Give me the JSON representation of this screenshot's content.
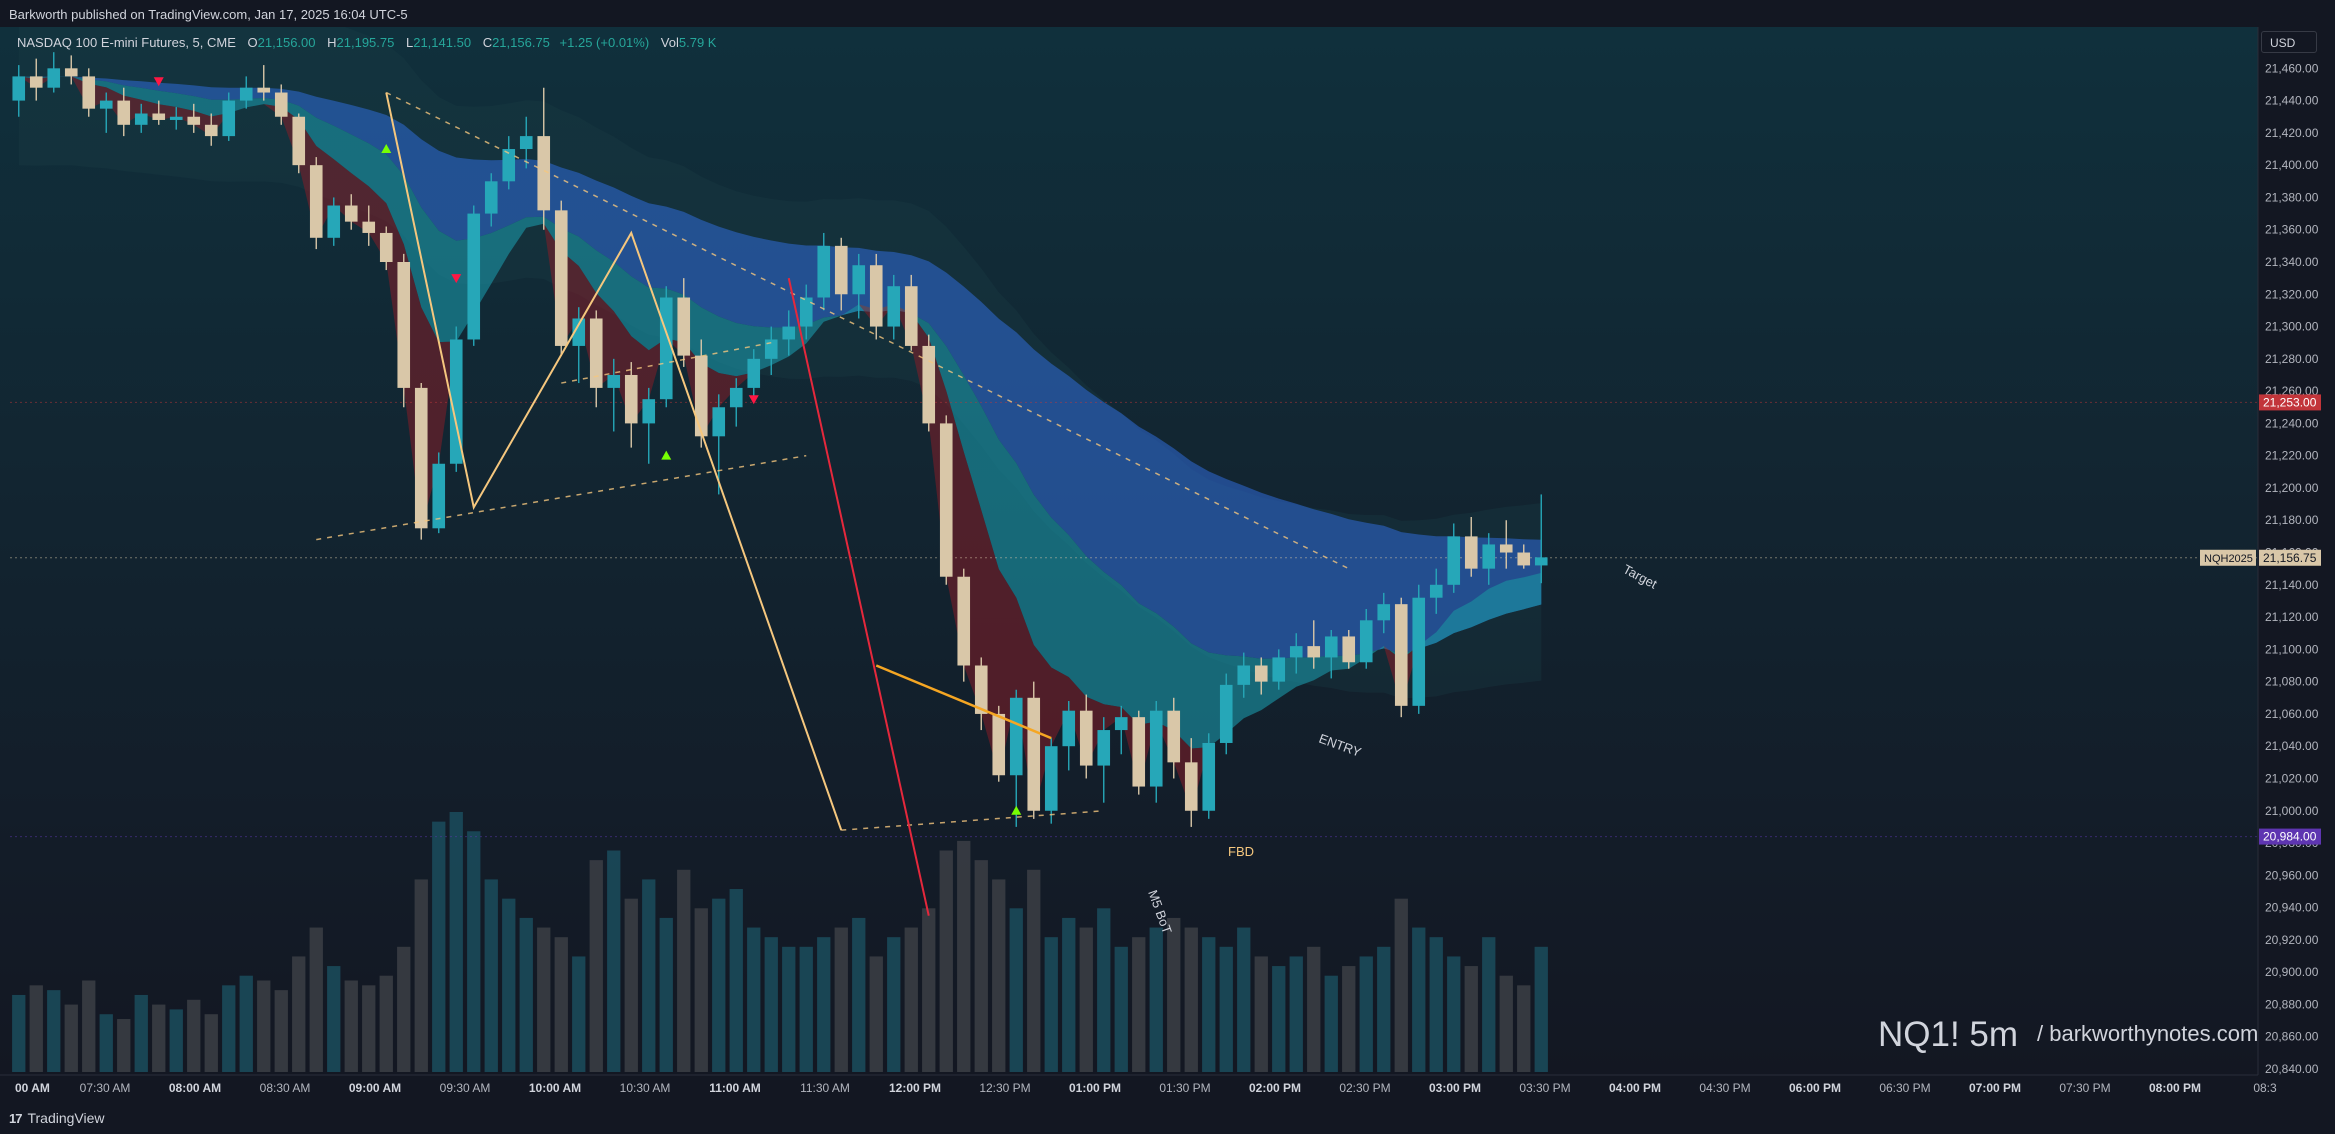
{
  "header": {
    "published": "Barkworth published on TradingView.com, Jan 17, 2025 16:04 UTC-5"
  },
  "legend": {
    "symbol": "NASDAQ 100 E-mini Futures, 5, CME",
    "o_label": "O",
    "o_value": "21,156.00",
    "h_label": "H",
    "h_value": "21,195.75",
    "l_label": "L",
    "l_value": "21,141.50",
    "c_label": "C",
    "c_value": "21,156.75",
    "change": "+1.25 (+0.01%)",
    "vol_label": "Vol",
    "vol_value": "5.79 K"
  },
  "currency_button": "USD",
  "footer": {
    "brand": "TradingView"
  },
  "watermark": {
    "title": "NQ1! 5m",
    "site": "/ barkworthynotes.com"
  },
  "colors": {
    "background": "#131722",
    "up_candle": "#26a7b8",
    "down_candle": "#d9c7a8",
    "ribbon_blue": "#2f6bd8",
    "ribbon_teal": "#1a8f9f",
    "pattern_line": "#f5c77e",
    "red_line": "#e5283c"
  },
  "chart_data": {
    "type": "candlestick",
    "title": "",
    "y_axis": {
      "range": [
        20830,
        21475
      ],
      "ticks": [
        "21,460.00",
        "21,440.00",
        "21,420.00",
        "21,400.00",
        "21,380.00",
        "21,360.00",
        "21,340.00",
        "21,320.00",
        "21,300.00",
        "21,280.00",
        "21,260.00",
        "21,240.00",
        "21,220.00",
        "21,200.00",
        "21,180.00",
        "21,160.00",
        "21,140.00",
        "21,120.00",
        "21,100.00",
        "21,080.00",
        "21,060.00",
        "21,040.00",
        "21,020.00",
        "21,000.00",
        "20,980.00",
        "20,960.00",
        "20,940.00",
        "20,920.00",
        "20,900.00",
        "20,880.00",
        "20,860.00",
        "20,840.00"
      ]
    },
    "x_axis": {
      "ticks": [
        {
          "label": "00 AM",
          "bold": true
        },
        {
          "label": "07:30 AM",
          "bold": false
        },
        {
          "label": "08:00 AM",
          "bold": true
        },
        {
          "label": "08:30 AM",
          "bold": false
        },
        {
          "label": "09:00 AM",
          "bold": true
        },
        {
          "label": "09:30 AM",
          "bold": false
        },
        {
          "label": "10:00 AM",
          "bold": true
        },
        {
          "label": "10:30 AM",
          "bold": false
        },
        {
          "label": "11:00 AM",
          "bold": true
        },
        {
          "label": "11:30 AM",
          "bold": false
        },
        {
          "label": "12:00 PM",
          "bold": true
        },
        {
          "label": "12:30 PM",
          "bold": false
        },
        {
          "label": "01:00 PM",
          "bold": true
        },
        {
          "label": "01:30 PM",
          "bold": false
        },
        {
          "label": "02:00 PM",
          "bold": true
        },
        {
          "label": "02:30 PM",
          "bold": false
        },
        {
          "label": "03:00 PM",
          "bold": true
        },
        {
          "label": "03:30 PM",
          "bold": false
        },
        {
          "label": "04:00 PM",
          "bold": true
        },
        {
          "label": "04:30 PM",
          "bold": false
        },
        {
          "label": "06:00 PM",
          "bold": true
        },
        {
          "label": "06:30 PM",
          "bold": false
        },
        {
          "label": "07:00 PM",
          "bold": true
        },
        {
          "label": "07:30 PM",
          "bold": false
        },
        {
          "label": "08:00 PM",
          "bold": true
        },
        {
          "label": "08:3",
          "bold": false
        }
      ]
    },
    "price_labels": [
      {
        "text": "21,253.00",
        "value": 21253,
        "color": "#c2353a"
      },
      {
        "text": "21,156.75",
        "value": 21156.75,
        "color": "#d9c7a8",
        "symbol": "NQH2025"
      },
      {
        "text": "20,984.00",
        "value": 20984,
        "color": "#5e35b1"
      }
    ],
    "annotations": [
      {
        "text": "Target",
        "value": 21150,
        "time": "03:45 PM"
      },
      {
        "text": "ENTRY",
        "value": 21045,
        "time": "02:10 PM"
      },
      {
        "text": "FBD",
        "value": 20972,
        "time": "01:55 PM"
      },
      {
        "text": "M5 BoT",
        "value": 20930,
        "time": "01:20 PM"
      }
    ],
    "candles": [
      [
        21440,
        21462,
        21430,
        21455
      ],
      [
        21455,
        21466,
        21440,
        21448
      ],
      [
        21448,
        21470,
        21445,
        21460
      ],
      [
        21460,
        21468,
        21450,
        21455
      ],
      [
        21455,
        21460,
        21430,
        21435
      ],
      [
        21435,
        21445,
        21420,
        21440
      ],
      [
        21440,
        21448,
        21418,
        21425
      ],
      [
        21425,
        21438,
        21420,
        21432
      ],
      [
        21432,
        21440,
        21425,
        21428
      ],
      [
        21428,
        21436,
        21422,
        21430
      ],
      [
        21430,
        21438,
        21420,
        21425
      ],
      [
        21425,
        21432,
        21412,
        21418
      ],
      [
        21418,
        21445,
        21415,
        21440
      ],
      [
        21440,
        21455,
        21435,
        21448
      ],
      [
        21448,
        21462,
        21440,
        21445
      ],
      [
        21445,
        21450,
        21425,
        21430
      ],
      [
        21430,
        21432,
        21395,
        21400
      ],
      [
        21400,
        21405,
        21348,
        21355
      ],
      [
        21355,
        21380,
        21350,
        21375
      ],
      [
        21375,
        21382,
        21360,
        21365
      ],
      [
        21365,
        21375,
        21350,
        21358
      ],
      [
        21358,
        21362,
        21335,
        21340
      ],
      [
        21340,
        21345,
        21250,
        21262
      ],
      [
        21262,
        21265,
        21168,
        21175
      ],
      [
        21175,
        21222,
        21172,
        21215
      ],
      [
        21215,
        21300,
        21210,
        21292
      ],
      [
        21292,
        21375,
        21288,
        21370
      ],
      [
        21370,
        21395,
        21362,
        21390
      ],
      [
        21390,
        21418,
        21385,
        21410
      ],
      [
        21410,
        21430,
        21398,
        21418
      ],
      [
        21418,
        21448,
        21360,
        21372
      ],
      [
        21372,
        21378,
        21282,
        21288
      ],
      [
        21288,
        21312,
        21265,
        21305
      ],
      [
        21305,
        21310,
        21250,
        21262
      ],
      [
        21262,
        21280,
        21235,
        21270
      ],
      [
        21270,
        21278,
        21225,
        21240
      ],
      [
        21240,
        21262,
        21215,
        21255
      ],
      [
        21255,
        21325,
        21250,
        21318
      ],
      [
        21318,
        21330,
        21275,
        21282
      ],
      [
        21282,
        21292,
        21225,
        21232
      ],
      [
        21232,
        21258,
        21196,
        21250
      ],
      [
        21250,
        21268,
        21238,
        21262
      ],
      [
        21262,
        21286,
        21255,
        21280
      ],
      [
        21280,
        21300,
        21270,
        21292
      ],
      [
        21292,
        21310,
        21282,
        21300
      ],
      [
        21300,
        21326,
        21292,
        21318
      ],
      [
        21318,
        21358,
        21310,
        21350
      ],
      [
        21350,
        21355,
        21310,
        21320
      ],
      [
        21320,
        21345,
        21305,
        21338
      ],
      [
        21338,
        21345,
        21292,
        21300
      ],
      [
        21300,
        21332,
        21292,
        21325
      ],
      [
        21325,
        21332,
        21285,
        21288
      ],
      [
        21288,
        21295,
        21235,
        21240
      ],
      [
        21240,
        21245,
        21140,
        21145
      ],
      [
        21145,
        21150,
        21080,
        21090
      ],
      [
        21090,
        21095,
        21050,
        21060
      ],
      [
        21060,
        21065,
        21018,
        21022
      ],
      [
        21022,
        21075,
        20990,
        21070
      ],
      [
        21070,
        21080,
        20995,
        21000
      ],
      [
        21000,
        21045,
        20992,
        21040
      ],
      [
        21040,
        21068,
        21025,
        21062
      ],
      [
        21062,
        21072,
        21020,
        21028
      ],
      [
        21028,
        21058,
        21005,
        21050
      ],
      [
        21050,
        21065,
        21035,
        21058
      ],
      [
        21058,
        21062,
        21010,
        21015
      ],
      [
        21015,
        21068,
        21005,
        21062
      ],
      [
        21062,
        21070,
        21020,
        21030
      ],
      [
        21030,
        21045,
        20990,
        21000
      ],
      [
        21000,
        21048,
        20995,
        21042
      ],
      [
        21042,
        21085,
        21035,
        21078
      ],
      [
        21078,
        21098,
        21070,
        21090
      ],
      [
        21090,
        21095,
        21072,
        21080
      ],
      [
        21080,
        21100,
        21075,
        21095
      ],
      [
        21095,
        21110,
        21085,
        21102
      ],
      [
        21102,
        21118,
        21088,
        21095
      ],
      [
        21095,
        21112,
        21082,
        21108
      ],
      [
        21108,
        21112,
        21088,
        21092
      ],
      [
        21092,
        21125,
        21088,
        21118
      ],
      [
        21118,
        21135,
        21110,
        21128
      ],
      [
        21128,
        21132,
        21058,
        21065
      ],
      [
        21065,
        21140,
        21060,
        21132
      ],
      [
        21132,
        21150,
        21122,
        21140
      ],
      [
        21140,
        21178,
        21135,
        21170
      ],
      [
        21170,
        21182,
        21145,
        21150
      ],
      [
        21150,
        21172,
        21140,
        21165
      ],
      [
        21165,
        21180,
        21150,
        21160
      ],
      [
        21160,
        21165,
        21150,
        21152
      ],
      [
        21152,
        21196,
        21141,
        21157
      ]
    ],
    "volume": [
      80,
      90,
      85,
      70,
      95,
      60,
      55,
      80,
      70,
      65,
      75,
      60,
      90,
      100,
      95,
      85,
      120,
      150,
      110,
      95,
      90,
      100,
      130,
      200,
      260,
      270,
      250,
      200,
      180,
      160,
      150,
      140,
      120,
      220,
      230,
      180,
      200,
      160,
      210,
      170,
      180,
      190,
      150,
      140,
      130,
      130,
      140,
      150,
      160,
      120,
      140,
      150,
      170,
      230,
      240,
      220,
      200,
      170,
      210,
      140,
      160,
      150,
      170,
      130,
      140,
      150,
      160,
      150,
      140,
      130,
      150,
      120,
      110,
      120,
      130,
      100,
      110,
      120,
      130,
      180,
      150,
      140,
      120,
      110,
      140,
      100,
      90,
      130
    ]
  }
}
